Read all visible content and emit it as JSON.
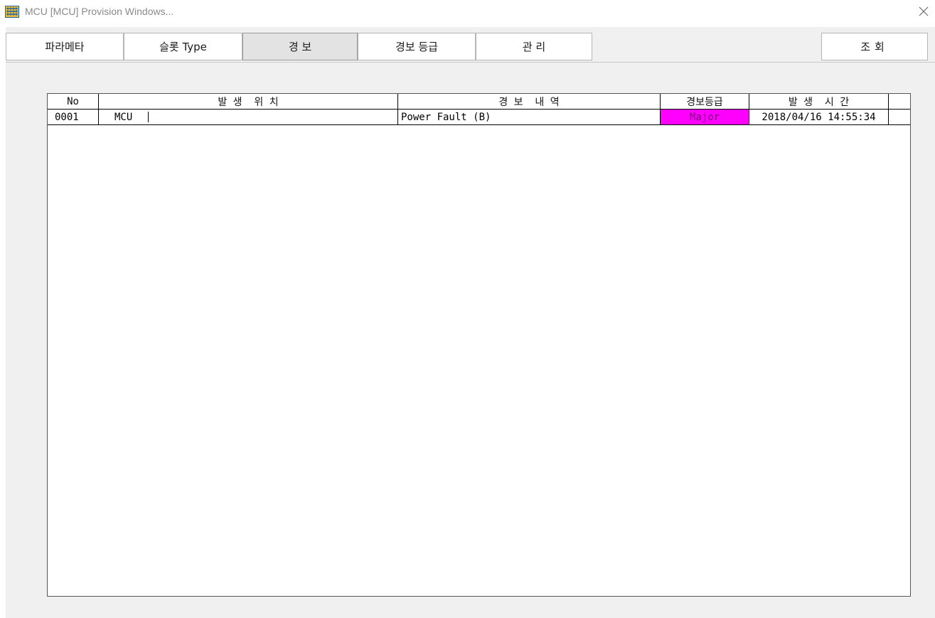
{
  "window": {
    "title": "MCU [MCU] Provision Windows...",
    "icon": "app-icon",
    "close_icon": "close-icon"
  },
  "tabs": [
    {
      "label": "파라메타",
      "active": false
    },
    {
      "label": "슬롯 Type",
      "active": false
    },
    {
      "label": "경 보",
      "active": true
    },
    {
      "label": "경보 등급",
      "active": false
    },
    {
      "label": "관 리",
      "active": false
    }
  ],
  "query_button": {
    "label": "조회"
  },
  "grid": {
    "columns": [
      "No",
      "발 생  위 치",
      "경 보  내 역",
      "경보등급",
      "발 생  시 간"
    ],
    "rows": [
      {
        "no": "0001",
        "location": "MCU",
        "description": "Power Fault (B)",
        "grade": "Major",
        "time": "2018/04/16 14:55:34"
      }
    ],
    "grade_color": "#ff00ff"
  }
}
